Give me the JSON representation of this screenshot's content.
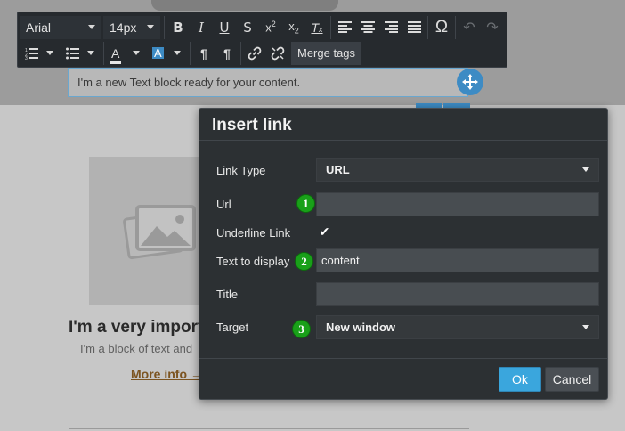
{
  "canvas": {
    "text_block": "I'm a new Text block ready for your content.",
    "heading": "I'm a very import",
    "paragraph": "I'm a block of text and",
    "link": "More info →"
  },
  "toolbar": {
    "font_family": "Arial",
    "font_size": "14px",
    "merge_tags": "Merge tags",
    "icons": [
      "bold-icon",
      "italic-icon",
      "underline-icon",
      "strikethrough-icon",
      "superscript-icon",
      "subscript-icon",
      "clear-formatting-icon",
      "align-left-icon",
      "align-center-icon",
      "align-right-icon",
      "align-justify-icon",
      "special-character-icon",
      "undo-icon",
      "redo-icon",
      "ordered-list-icon",
      "unordered-list-icon",
      "font-color-icon",
      "background-color-icon",
      "ltr-icon",
      "rtl-icon",
      "link-icon",
      "unlink-icon"
    ]
  },
  "dialog": {
    "title": "Insert link",
    "link_type_label": "Link Type",
    "link_type_value": "URL",
    "url_label": "Url",
    "url_value": "",
    "underline_label": "Underline Link",
    "underline_checked": true,
    "text_label": "Text to display",
    "text_value": "content",
    "title_label": "Title",
    "title_value": "",
    "target_label": "Target",
    "target_value": "New window",
    "ok_label": "Ok",
    "cancel_label": "Cancel"
  },
  "badges": [
    "1",
    "2",
    "3"
  ],
  "colors": {
    "accent": "#3aa6dd",
    "badge": "#19a019",
    "dialog_bg": "#2c3033",
    "toolbar_bg": "#262a2e"
  }
}
